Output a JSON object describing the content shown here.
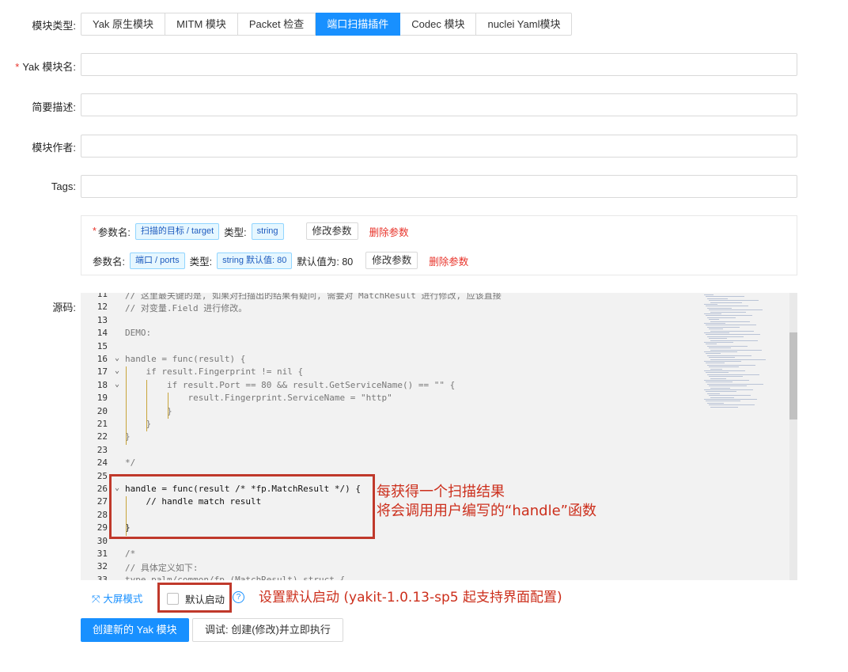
{
  "module_type": {
    "label": "模块类型:",
    "options": [
      "Yak 原生模块",
      "MITM 模块",
      "Packet 检查",
      "端口扫描插件",
      "Codec 模块",
      "nuclei Yaml模块"
    ],
    "selected_index": 3
  },
  "form": {
    "name_label": "Yak 模块名:",
    "desc_label": "简要描述:",
    "author_label": "模块作者:",
    "tags_label": "Tags:",
    "source_label": "源码:"
  },
  "params": {
    "row1": {
      "name_label": "参数名:",
      "name_tag": "扫描的目标 / target",
      "type_label": "类型:",
      "type_tag": "string",
      "modify": "修改参数",
      "delete": "删除参数"
    },
    "row2": {
      "name_label": "参数名:",
      "name_tag": "端口 / ports",
      "type_label": "类型:",
      "type_tag": "string 默认值: 80",
      "default_text": "默认值为: 80",
      "modify": "修改参数",
      "delete": "删除参数"
    }
  },
  "code_lines": [
    {
      "n": "11",
      "t": "// 这里最关键的是, 如果对扫描出的结果有疑问, 需要对 MatchResult 进行修改, 应该直接"
    },
    {
      "n": "12",
      "t": "// 对变量.Field 进行修改。"
    },
    {
      "n": "13",
      "t": ""
    },
    {
      "n": "14",
      "t": "DEMO:"
    },
    {
      "n": "15",
      "t": ""
    },
    {
      "n": "16",
      "t": "handle = func(result) {"
    },
    {
      "n": "17",
      "t": "    if result.Fingerprint != nil {"
    },
    {
      "n": "18",
      "t": "        if result.Port == 80 && result.GetServiceName() == \"\" {"
    },
    {
      "n": "19",
      "t": "            result.Fingerprint.ServiceName = \"http\""
    },
    {
      "n": "20",
      "t": "        }"
    },
    {
      "n": "21",
      "t": "    }"
    },
    {
      "n": "22",
      "t": "}"
    },
    {
      "n": "23",
      "t": ""
    },
    {
      "n": "24",
      "t": "*/"
    },
    {
      "n": "25",
      "t": ""
    },
    {
      "n": "26",
      "t": "handle = func(result /* *fp.MatchResult */) {"
    },
    {
      "n": "27",
      "t": "    // handle match result"
    },
    {
      "n": "28",
      "t": ""
    },
    {
      "n": "29",
      "t": "}"
    },
    {
      "n": "30",
      "t": ""
    },
    {
      "n": "31",
      "t": "/*"
    },
    {
      "n": "32",
      "t": "// 具体定义如下:"
    },
    {
      "n": "33",
      "t": "type palm/common/fp.(MatchResult) struct {"
    }
  ],
  "annotations": {
    "handle_line1": "每获得一个扫描结果",
    "handle_line2": "将会调用用户编写的“handle”函数",
    "default_start": "设置默认启动 (yakit-1.0.13-sp5 起支持界面配置)"
  },
  "bottom": {
    "fullscreen": "大屏模式",
    "default_checkbox": "默认启动",
    "help_icon": "?",
    "create_button": "创建新的 Yak 模块",
    "debug_button": "调试: 创建(修改)并立即执行"
  },
  "colors": {
    "primary": "#1890ff",
    "danger": "#e8332a",
    "annotation": "#c0392b"
  }
}
